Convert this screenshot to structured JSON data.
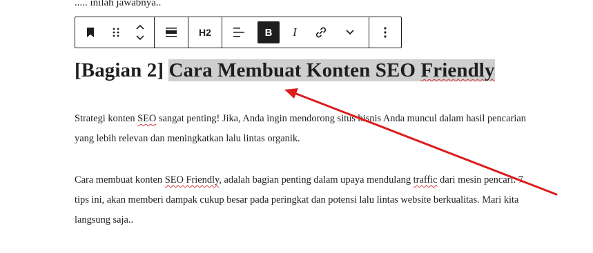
{
  "top_text": "..... inilah jawabnya..",
  "toolbar": {
    "heading_level": "H2",
    "bold": "B",
    "italic": "I",
    "icons": [
      "bookmark-icon",
      "drag-handle-icon",
      "move-up-down-icon",
      "align-block-icon",
      "align-text-icon",
      "link-icon",
      "chevron-down-icon",
      "more-options-icon"
    ]
  },
  "heading": {
    "prefix": "[Bagian 2]",
    "highlight_words": [
      "Cara",
      "Membuat",
      "Konten",
      "SEO",
      "Friendly"
    ]
  },
  "paragraph1": {
    "a": "Strategi konten",
    "b": "SEO",
    "c": "sangat penting! Jika, Anda ingin mendorong situs bisnis Anda muncul dalam hasil pencarian yang lebih relevan dan meningkatkan lalu lintas organik."
  },
  "paragraph2": {
    "a": "Cara membuat konten",
    "b": "SEO Friendly",
    "c": ", adalah bagian penting dalam upaya mendulang",
    "d": "traffic",
    "e": "dari mesin pencari. 7 tips ini, akan memberi dampak cukup besar pada peringkat dan potensi lalu lintas website berkualitas. Mari kita langsung saja.."
  },
  "colors": {
    "arrow": "#dd1c1c",
    "highlight": "#cfcfcf",
    "toolbar_active": "#1e1e1e"
  }
}
